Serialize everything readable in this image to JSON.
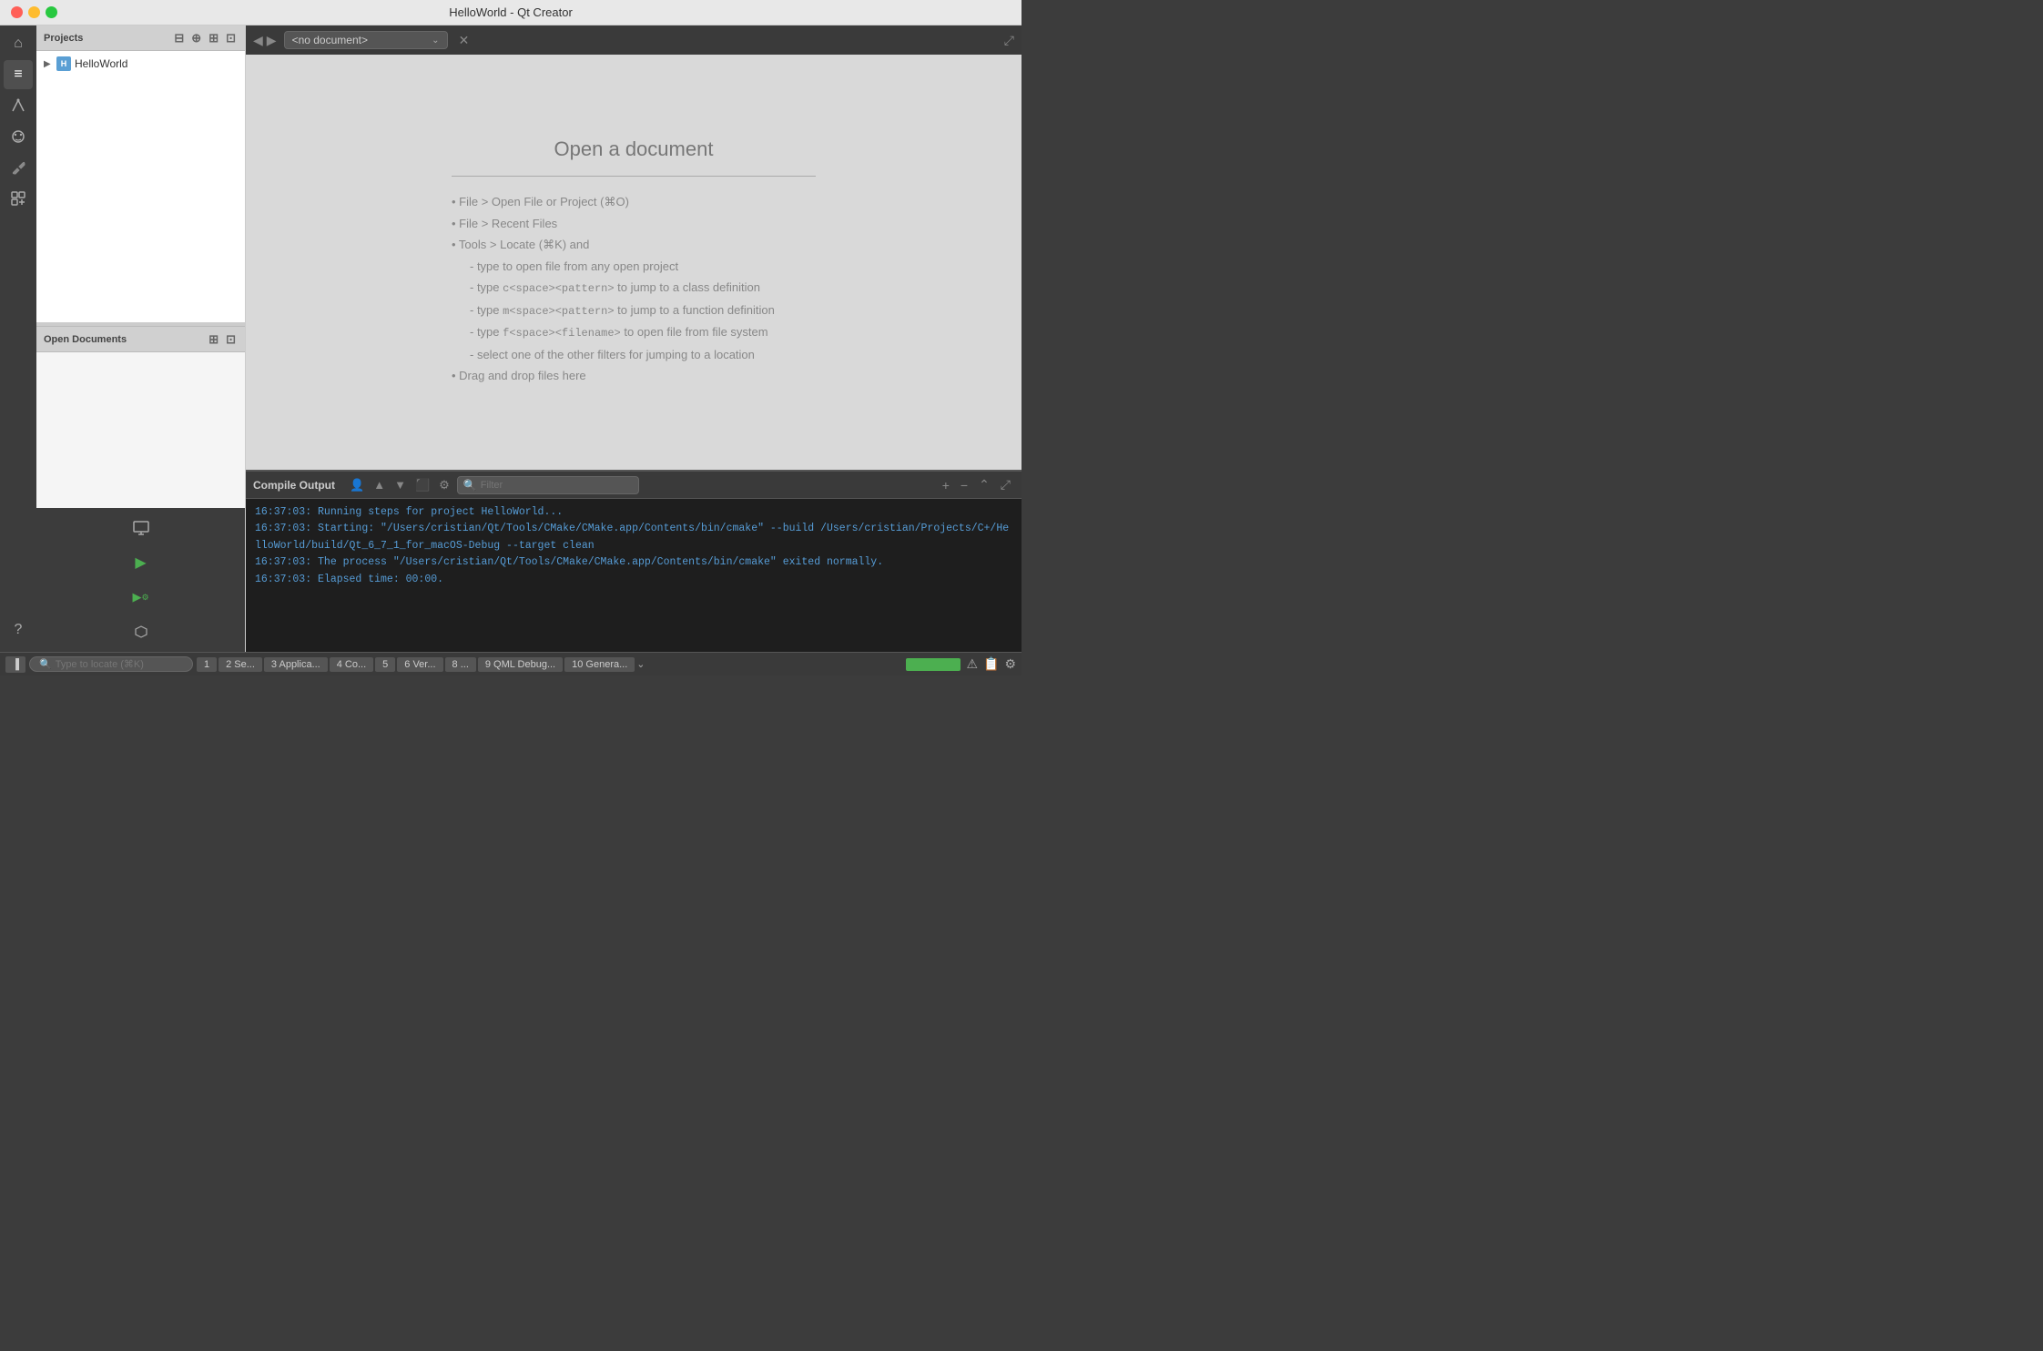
{
  "titlebar": {
    "title": "HelloWorld - Qt Creator"
  },
  "sidebar": {
    "projects_label": "Projects",
    "project_name": "HelloWorld",
    "open_docs_label": "Open Documents"
  },
  "editor": {
    "no_document_label": "<no document>",
    "open_doc_title": "Open a document",
    "instructions": [
      "• File > Open File or Project (⌘O)",
      "• File > Recent Files",
      "• Tools > Locate (⌘K) and",
      "    - type to open file from any open project",
      "    - type c<space><pattern> to jump to a class definition",
      "    - type m<space><pattern> to jump to a function definition",
      "    - type f<space><filename> to open file from file system",
      "    - select one of the other filters for jumping to a location",
      "• Drag and drop files here"
    ]
  },
  "compile_output": {
    "header_label": "Compile Output",
    "filter_placeholder": "Filter",
    "lines": [
      "16:37:03: Running steps for project HelloWorld...",
      "16:37:03: Starting: \"/Users/cristian/Qt/Tools/CMake/CMake.app/Contents/bin/cmake\" --build /Users/cristian/Projects/C+/HelloWorld/build/Qt_6_7_1_for_macOS-Debug --target clean",
      "16:37:03: The process \"/Users/cristian/Qt/Tools/CMake/CMake.app/Contents/bin/cmake\" exited normally.",
      "16:37:03: Elapsed time: 00:00."
    ]
  },
  "statusbar": {
    "search_placeholder": "Type to locate (⌘K)",
    "tabs": [
      {
        "id": 1,
        "label": "1"
      },
      {
        "id": 2,
        "label": "2 Se..."
      },
      {
        "id": 3,
        "label": "3 Applica..."
      },
      {
        "id": 4,
        "label": "4 Co..."
      },
      {
        "id": 5,
        "label": "5"
      },
      {
        "id": 6,
        "label": "6 Ver..."
      },
      {
        "id": 8,
        "label": "8 ..."
      },
      {
        "id": 9,
        "label": "9 QML Debug..."
      },
      {
        "id": 10,
        "label": "10 Genera..."
      }
    ]
  },
  "icons": {
    "home": "⌂",
    "editor": "≡",
    "design": "✏",
    "debug": "🐛",
    "tools": "🔧",
    "extensions": "⊞",
    "help": "?",
    "run": "▶",
    "run_debug": "▶",
    "kit": "⚙",
    "monitor": "🖥"
  }
}
